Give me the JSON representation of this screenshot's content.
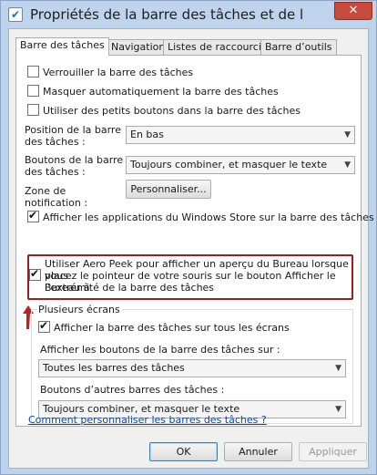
{
  "window": {
    "title": "Propriétés de la barre des tâches et de la navigati...",
    "close_glyph": "✕"
  },
  "tabs": [
    "Barre des tâches",
    "Navigation",
    "Listes de raccourcis",
    "Barre d’outils"
  ],
  "options": {
    "lock": "Verrouiller la barre des tâches",
    "autohide": "Masquer automatiquement la barre des tâches",
    "small_buttons": "Utiliser des petits boutons dans la barre des tâches",
    "position_label": "Position de la barre des tâches :",
    "position_value": "En bas",
    "buttons_label": "Boutons de la barre des tâches :",
    "buttons_value": "Toujours combiner, et masquer le texte",
    "notif_label": "Zone de notification :",
    "customize": "Personnaliser...",
    "store_apps": "Afficher les applications du Windows Store sur la barre des tâches",
    "peek_line1": "Utiliser Aero Peek pour afficher un aperçu du Bureau lorsque vous",
    "peek_line2": "placez le pointeur de votre souris sur le bouton Afficher le Bureau à",
    "peek_line3": "l’extrémité de la barre des tâches"
  },
  "multi_screen": {
    "title": "Plusieurs écrans",
    "show_all": "Afficher la barre des tâches sur tous les écrans",
    "show_buttons_label": "Afficher les boutons de la barre des tâches sur :",
    "show_buttons_value": "Toutes les barres des tâches",
    "other_buttons_label": "Boutons d’autres barres des tâches :",
    "other_buttons_value": "Toujours combiner, et masquer le texte"
  },
  "help_link": "Comment personnaliser les barres des tâches ?",
  "footer": {
    "ok": "OK",
    "cancel": "Annuler",
    "apply": "Appliquer"
  },
  "colors": {
    "highlight": "#a11d1d",
    "annotation_arrow": "#c0201f",
    "link": "#0645ad"
  }
}
